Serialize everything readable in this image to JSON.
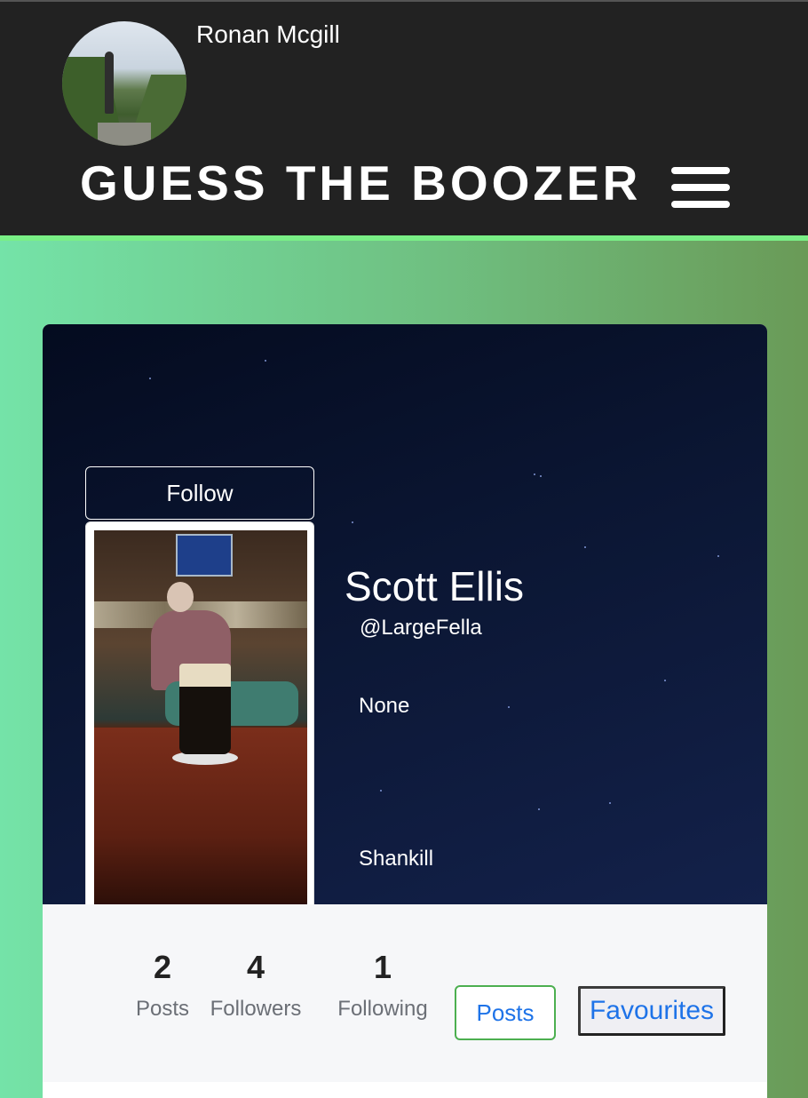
{
  "header": {
    "username": "Ronan Mcgill",
    "brand": "GUESS THE BOOZER",
    "menu_icon": "hamburger-menu-icon"
  },
  "profile": {
    "follow_label": "Follow",
    "display_name": "Scott Ellis",
    "handle": "@LargeFella",
    "bio": "None",
    "location": "Shankill"
  },
  "stats": {
    "posts_count": "2",
    "posts_label": "Posts",
    "followers_count": "4",
    "followers_label": "Followers",
    "following_count": "1",
    "following_label": "Following"
  },
  "tabs": {
    "posts_label": "Posts",
    "favourites_label": "Favourites"
  },
  "colors": {
    "header_bg": "#222222",
    "accent_line": "#79ef86",
    "link_blue": "#1e73e8",
    "posts_tab_border": "#4caf50"
  }
}
